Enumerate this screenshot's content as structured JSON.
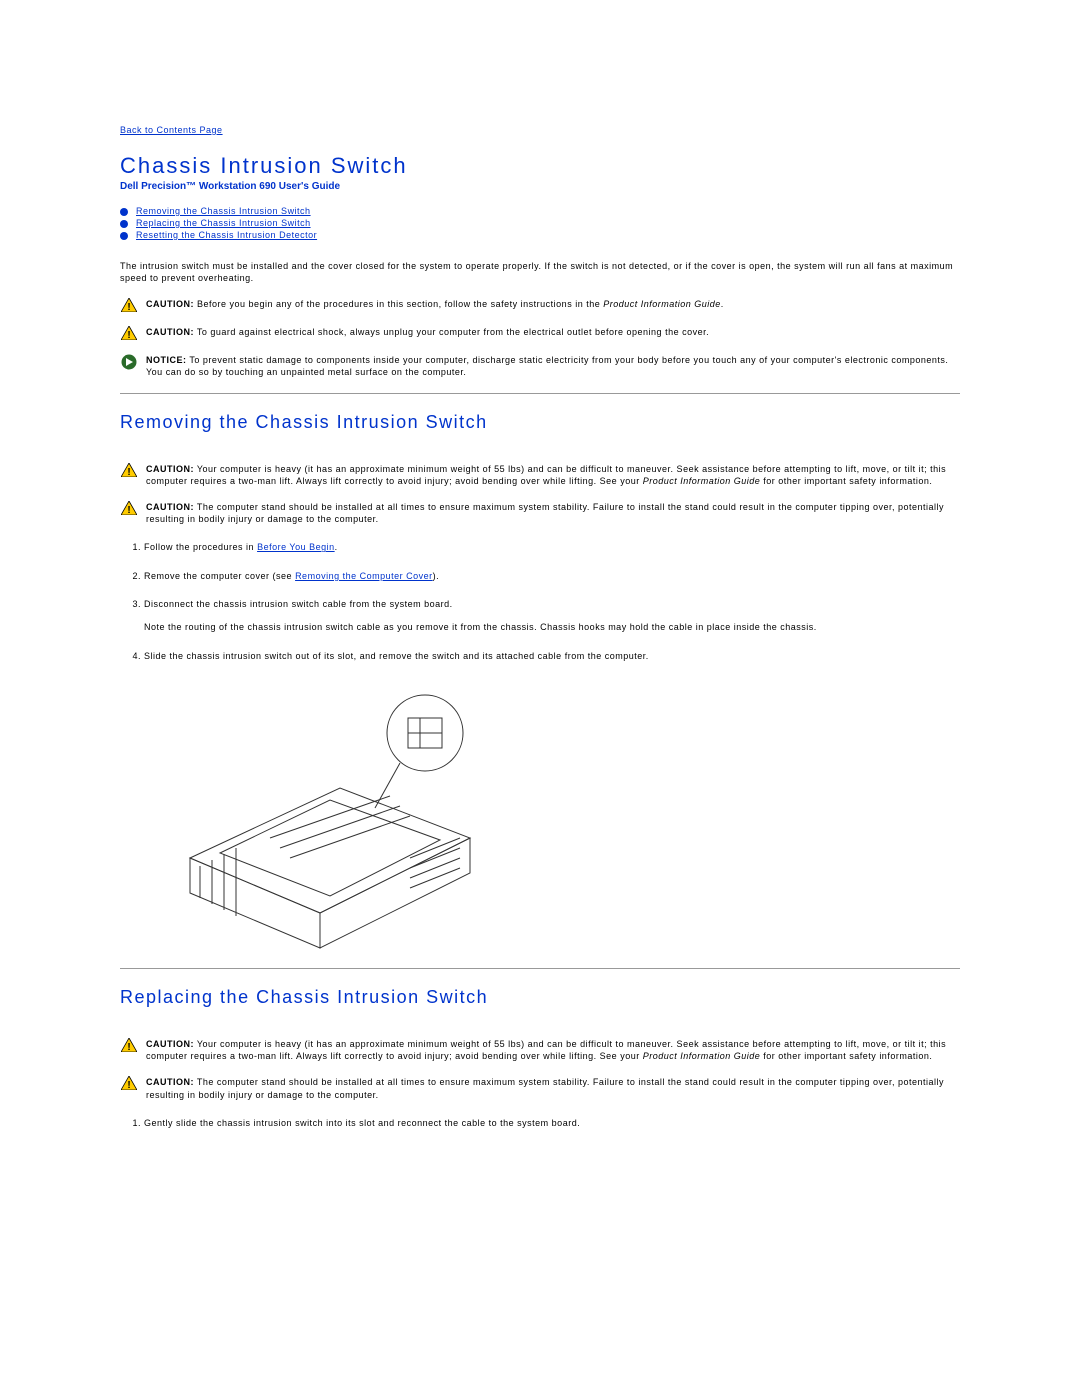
{
  "nav": {
    "back_link": "Back to Contents Page"
  },
  "header": {
    "title": "Chassis Intrusion Switch",
    "subtitle": "Dell Precision™ Workstation 690 User's Guide"
  },
  "toc": [
    "Removing the Chassis Intrusion Switch",
    "Replacing the Chassis Intrusion Switch",
    "Resetting the Chassis Intrusion Detector"
  ],
  "intro": "The intrusion switch must be installed and the cover closed for the system to operate properly. If the switch is not detected, or if the cover is open, the system will run all fans at maximum speed to prevent overheating.",
  "labels": {
    "caution": "CAUTION:",
    "notice": "NOTICE:",
    "pig": "Product Information Guide"
  },
  "top_notices": {
    "c1_before": " Before you begin any of the procedures in this section, follow the safety instructions in the ",
    "c1_after": ".",
    "c2": " To guard against electrical shock, always unplug your computer from the electrical outlet before opening the cover.",
    "n1": " To prevent static damage to components inside your computer, discharge static electricity from your body before you touch any of your computer's electronic components. You can do so by touching an unpainted metal surface on the computer."
  },
  "section1": {
    "heading": "Removing the Chassis Intrusion Switch",
    "c_heavy_before": " Your computer is heavy (it has an approximate minimum weight of 55 lbs) and can be difficult to maneuver. Seek assistance before attempting to lift, move, or tilt it; this computer requires a two-man lift. Always lift correctly to avoid injury; avoid bending over while lifting. See your ",
    "c_heavy_after": " for other important safety information.",
    "c_stand": " The computer stand should be installed at all times to ensure maximum system stability. Failure to install the stand could result in the computer tipping over, potentially resulting in bodily injury or damage to the computer.",
    "steps": {
      "s1_a": "Follow the procedures in ",
      "s1_link": "Before You Begin",
      "s1_b": ".",
      "s2_a": "Remove the computer cover (see ",
      "s2_link": "Removing the Computer Cover",
      "s2_b": ").",
      "s3": "Disconnect the chassis intrusion switch cable from the system board.",
      "s3_note": "Note the routing of the chassis intrusion switch cable as you remove it from the chassis. Chassis hooks may hold the cable in place inside the chassis.",
      "s4": "Slide the chassis intrusion switch out of its slot, and remove the switch and its attached cable from the computer."
    }
  },
  "section2": {
    "heading": "Replacing the Chassis Intrusion Switch",
    "c_heavy_before": " Your computer is heavy (it has an approximate minimum weight of 55 lbs) and can be difficult to maneuver. Seek assistance before attempting to lift, move, or tilt it; this computer requires a two-man lift. Always lift correctly to avoid injury; avoid bending over while lifting. See your ",
    "c_heavy_after": " for other important safety information.",
    "c_stand": " The computer stand should be installed at all times to ensure maximum system stability. Failure to install the stand could result in the computer tipping over, potentially resulting in bodily injury or damage to the computer.",
    "steps": {
      "s1": "Gently slide the chassis intrusion switch into its slot and reconnect the cable to the system board."
    }
  }
}
